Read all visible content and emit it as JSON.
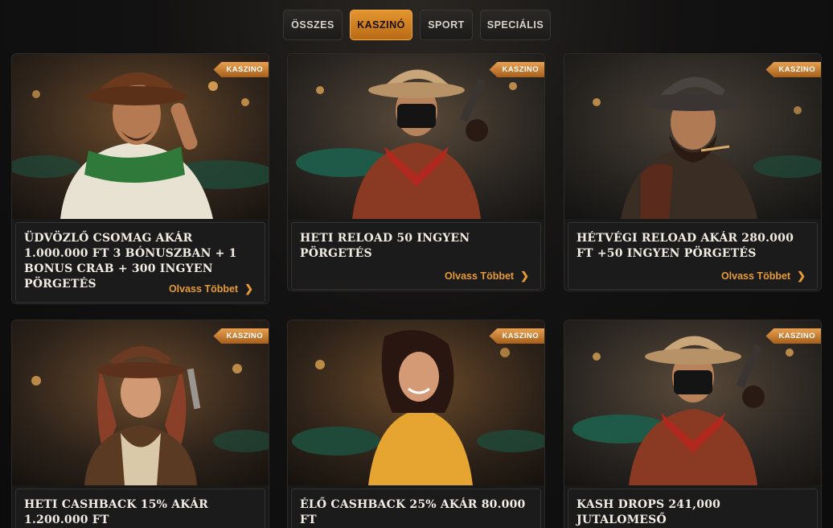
{
  "tabs": [
    {
      "label": "ÖSSZES",
      "active": false
    },
    {
      "label": "KASZINÓ",
      "active": true
    },
    {
      "label": "SPORT",
      "active": false
    },
    {
      "label": "SPECIÁLIS",
      "active": false
    }
  ],
  "cards": [
    {
      "badge": "KASZINO",
      "title": "Üdvözlő csomag akár 1.000.000 Ft 3 bónuszban + 1 Bonus Crab + 300 ingyen pörgetés",
      "more": "Olvass Többet",
      "image": "cowboy-green-scarf"
    },
    {
      "badge": "KASZINO",
      "title": "Heti Reload 50 ingyen pörgetés",
      "more": "Olvass Többet",
      "image": "masked-gunslinger"
    },
    {
      "badge": "KASZINO",
      "title": "Hétvégi Reload akár 280.000 Ft +50 ingyen pörgetés",
      "more": "Olvass Többet",
      "image": "bearded-cowboy"
    },
    {
      "badge": "KASZINO",
      "title": "Heti Cashback 15% akár 1.200.000 Ft",
      "more": "",
      "image": "cowgirl-revolver"
    },
    {
      "badge": "KASZINO",
      "title": "Élő Cashback 25% akár 80.000 Ft",
      "more": "",
      "image": "woman-yellow-dress"
    },
    {
      "badge": "KASZINO",
      "title": "Kash Drops 241,000 jutalomeső",
      "more": "",
      "image": "masked-gunslinger"
    }
  ],
  "colors": {
    "accent": "#e69a38",
    "card_bg": "#1a1919"
  }
}
